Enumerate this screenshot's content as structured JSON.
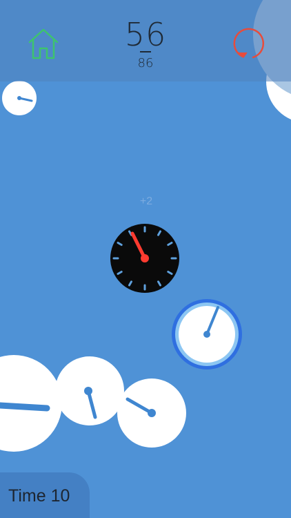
{
  "header": {
    "score": "56",
    "best_score": "86",
    "home_icon": "home-icon",
    "restart_icon": "restart-icon"
  },
  "board": {
    "bonus_text": "+2",
    "active_clock": {
      "face_color": "#0a0a0a",
      "hand_color": "#ff3b30",
      "tick_color": "#5fa0dc"
    },
    "target_clock": {
      "face_color": "#ffffff",
      "ring_color": "#2f6fe0"
    },
    "clock_face_color": "#ffffff",
    "hand_color": "#3f86d0"
  },
  "footer": {
    "time_label": "Time 10"
  },
  "colors": {
    "background": "#4f92d6",
    "home_icon": "#3ec46d",
    "restart_icon": "#e74c3c"
  }
}
